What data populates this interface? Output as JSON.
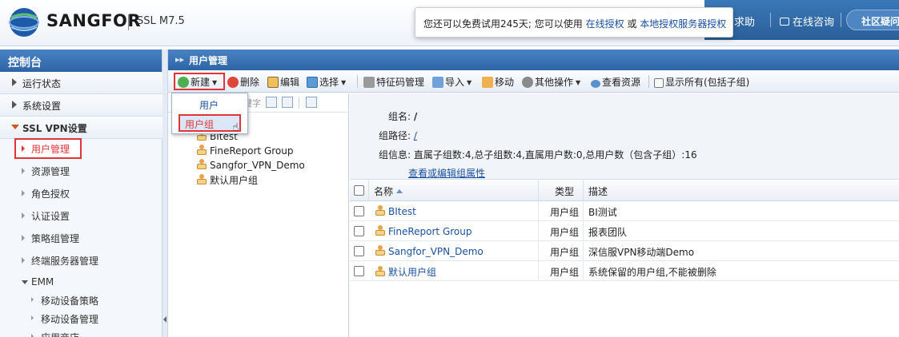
{
  "header": {
    "brand": "SANGFOR",
    "version": "SSL M7.5",
    "links": [
      "求助",
      "在线咨询"
    ],
    "community": "社区疑问"
  },
  "notice": {
    "text_before": "您还可以免费试用245天; 您可以使用",
    "link1": "在线授权",
    "middle": "或",
    "link2": "本地授权服务器授权"
  },
  "nav": {
    "title": "控制台",
    "items": [
      "运行状态",
      "系统设置",
      "SSL VPN设置"
    ],
    "sub_items": [
      "用户管理",
      "资源管理",
      "角色授权",
      "认证设置",
      "策略组管理",
      "终端服务器管理"
    ],
    "emm": "EMM",
    "emm_items": [
      "移动设备策略",
      "移动设备管理",
      "应用商店"
    ]
  },
  "panel": {
    "title": "用户管理"
  },
  "toolbar": {
    "new": "新建",
    "delete": "删除",
    "edit": "编辑",
    "select": "选择",
    "feature_code": "特征码管理",
    "import": "导入",
    "move": "移动",
    "other_ops": "其他操作",
    "view_resources": "查看资源",
    "show_all": "显示所有(包括子组)"
  },
  "dropdown": {
    "items": [
      "用户",
      "用户组"
    ]
  },
  "tree": {
    "search_placeholder": "键字",
    "nodes": [
      "BItest",
      "FineReport Group",
      "Sangfor_VPN_Demo",
      "默认用户组"
    ]
  },
  "info": {
    "group_name_label": "组名:",
    "group_name": "/",
    "group_path_label": "组路径:",
    "group_path": "/",
    "group_info_label": "组信息:",
    "group_info": "直属子组数:4,总子组数:4,直属用户数:0,总用户数（包含子组）:16",
    "edit_link": "查看或编辑组属性"
  },
  "grid": {
    "columns": [
      "名称",
      "类型",
      "描述"
    ],
    "rows": [
      {
        "name": "BItest",
        "type": "用户组",
        "desc": "BI测试"
      },
      {
        "name": "FineReport Group",
        "type": "用户组",
        "desc": "报表团队"
      },
      {
        "name": "Sangfor_VPN_Demo",
        "type": "用户组",
        "desc": "深信服VPN移动端Demo"
      },
      {
        "name": "默认用户组",
        "type": "用户组",
        "desc": "系统保留的用户组,不能被删除"
      }
    ]
  },
  "colors": {
    "accent": "#2c64a6",
    "highlight": "#e0343a",
    "link": "#1a4f9c"
  }
}
